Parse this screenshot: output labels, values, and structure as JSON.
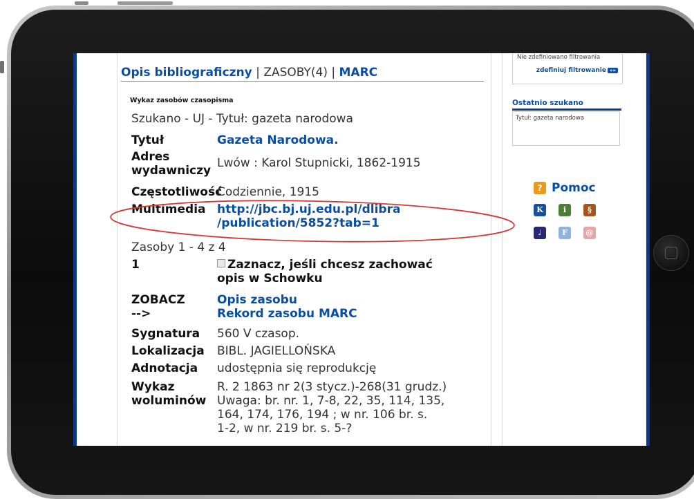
{
  "tabs": {
    "opis": "Opis bibliograficzny",
    "sep1": " | ",
    "zasoby": "ZASOBY(4)",
    "sep2": " | ",
    "marc": "MARC"
  },
  "section_title": "Wykaz zasobów czasopisma",
  "searched": "Szukano - UJ - Tytuł: gazeta narodowa",
  "record": {
    "title_label": "Tytuł",
    "title_value": "Gazeta Narodowa.",
    "adres_label_1": "Adres",
    "adres_label_2": "wydawniczy",
    "adres_value": "Lwów : Karol Stupnicki, 1862-1915",
    "czest_label": "Częstotliwość",
    "czest_value": "Codziennie, 1915",
    "multi_label": "Multimedia",
    "multi_value_1": "http://jbc.bj.uj.edu.pl/dlibra",
    "multi_value_2": "/publication/5852?tab=1"
  },
  "holdings_count": "Zasoby 1 - 4 z 4",
  "holding": {
    "number": "1",
    "checkbox_text_1": "Zaznacz, jeśli chcesz zachować",
    "checkbox_text_2": "opis w Schowku",
    "zobacz_label_1": "ZOBACZ",
    "zobacz_label_2": "-->",
    "opis_zasobu": "Opis zasobu",
    "rekord_marc": "Rekord zasobu MARC",
    "sygnatura_label": "Sygnatura",
    "sygnatura_value": "560 V czasop.",
    "lokalizacja_label": "Lokalizacja",
    "lokalizacja_value": "BIBL. JAGIELLOŃSKA",
    "adnotacja_label": "Adnotacja",
    "adnotacja_value": "udostępnia się reprodukcję",
    "wykaz_label_1": "Wykaz",
    "wykaz_label_2": "woluminów",
    "wykaz_value_1": "R. 2 1863 nr 2(3 stycz.)-268(31 grudz.)",
    "wykaz_value_2": "Uwaga: br. nr. 1, 7-8, 22, 35, 114, 135,",
    "wykaz_value_3": "164, 174, 176, 194 ; w nr. 106 br. s.",
    "wykaz_value_4": "1-2, w nr. 219 br. s. 5-?"
  },
  "sidebar": {
    "filter_text": "Nie zdefiniowano filtrowania",
    "filter_button": "zdefiniuj filtrowanie",
    "filter_arrow": "»»",
    "recent_title": "Ostatnio szukano",
    "recent_item": "Tytuł: gazeta narodowa",
    "help_label": "Pomoc",
    "help_icon_char": "?",
    "icons": {
      "k": "K",
      "i": "i",
      "s": "§",
      "j": "♩",
      "f": "F",
      "at": "@"
    }
  },
  "colors": {
    "link": "#0a4ea3",
    "border_blue": "#0b3a8a",
    "annotation": "#d23a3a"
  }
}
